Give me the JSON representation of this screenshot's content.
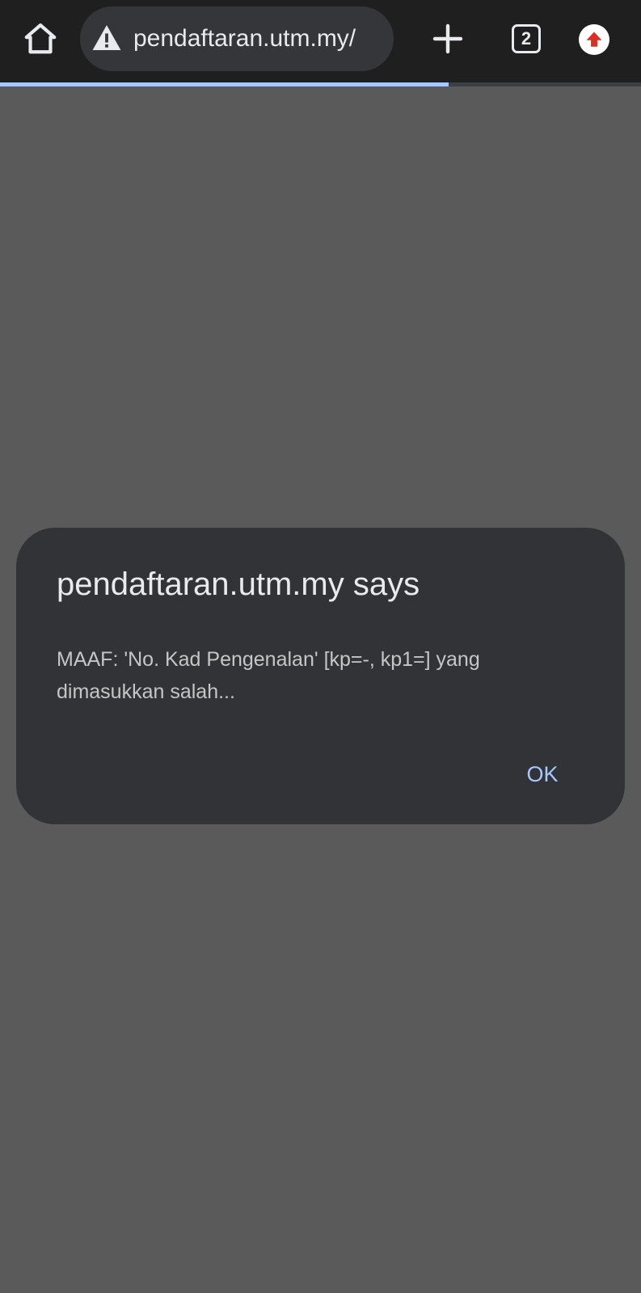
{
  "browser": {
    "url": "pendaftaran.utm.my/",
    "tab_count": "2",
    "page_load_progress": 0.7,
    "icons": {
      "home": "home-icon",
      "security": "warning-icon",
      "new_tab": "plus-icon",
      "tabs": "tab-switcher-icon",
      "update": "update-arrow-icon"
    },
    "colors": {
      "toolbar": "#1f1f1f",
      "omnibox": "#35363a",
      "progress": "#a8c7fa",
      "update_badge": "#d93025"
    }
  },
  "page": {
    "background": "#5a5a5a"
  },
  "dialog": {
    "title": "pendaftaran.utm.my says",
    "message": "MAAF: 'No. Kad Pengenalan' [kp=-, kp1=] yang dimasukkan salah...",
    "ok_label": "OK",
    "colors": {
      "surface": "#323337",
      "accent": "#a8c7fa"
    }
  }
}
